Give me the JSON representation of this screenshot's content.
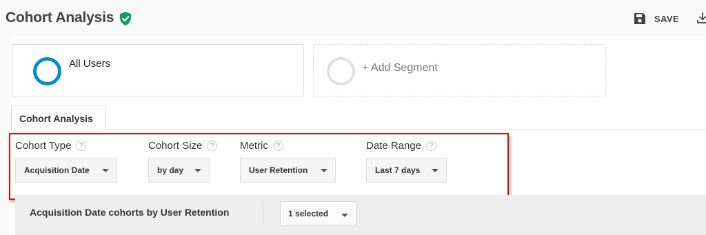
{
  "header": {
    "title": "Cohort Analysis",
    "verified_icon": "shield-check-icon",
    "save_label": "SAVE",
    "save_icon": "floppy-disk-icon",
    "download_icon": "download-icon"
  },
  "segments": {
    "active_label": "All Users",
    "add_label": "+ Add Segment",
    "active_color": "#058dc7"
  },
  "tab": {
    "label": "Cohort Analysis"
  },
  "controls": {
    "cohort_type": {
      "label": "Cohort Type",
      "value": "Acquisition Date"
    },
    "cohort_size": {
      "label": "Cohort Size",
      "value": "by day"
    },
    "metric": {
      "label": "Metric",
      "value": "User Retention"
    },
    "date_range": {
      "label": "Date Range",
      "value": "Last 7 days"
    },
    "help_glyph": "?"
  },
  "table_header": {
    "title": "Acquisition Date cohorts by User Retention",
    "selected_value": "1 selected"
  },
  "colors": {
    "highlight_border": "#b71c1c",
    "verified_green": "#0f9d58"
  }
}
